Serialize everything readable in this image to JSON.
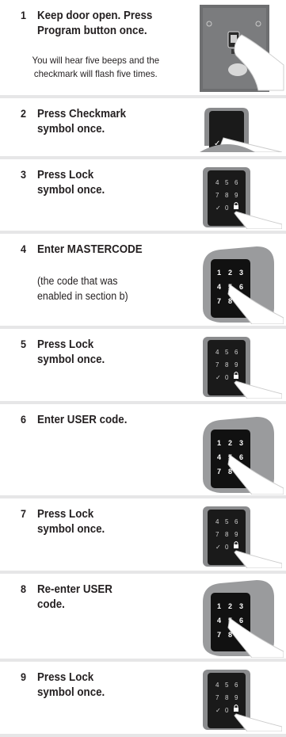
{
  "steps": [
    {
      "number": "1",
      "title_lines": [
        "Keep door open. Press",
        "Program button once."
      ],
      "note_lines": [
        "You will hear five beeps and the",
        "checkmark will flash five times."
      ]
    },
    {
      "number": "2",
      "title_lines": [
        "Press Checkmark",
        "symbol once."
      ]
    },
    {
      "number": "3",
      "title_lines": [
        "Press Lock",
        "symbol once."
      ],
      "keypad": [
        "4",
        "5",
        "6",
        "7",
        "8",
        "9",
        "✓",
        "0",
        "🔒"
      ]
    },
    {
      "number": "4",
      "title_lines": [
        "Enter MASTERCODE"
      ],
      "note_lines": [
        "(the code that was",
        "enabled in section b)"
      ],
      "keypad": [
        "1",
        "2",
        "3",
        "4",
        "5",
        "6",
        "7",
        "8"
      ]
    },
    {
      "number": "5",
      "title_lines": [
        "Press Lock",
        "symbol once."
      ],
      "keypad": [
        "4",
        "5",
        "6",
        "7",
        "8",
        "9",
        "✓",
        "0",
        "🔒"
      ]
    },
    {
      "number": "6",
      "title_lines": [
        "Enter USER code."
      ],
      "keypad": [
        "1",
        "2",
        "3",
        "4",
        "5",
        "6",
        "7",
        "8"
      ]
    },
    {
      "number": "7",
      "title_lines": [
        "Press Lock",
        "symbol once."
      ],
      "keypad": [
        "4",
        "5",
        "6",
        "7",
        "8",
        "9",
        "✓",
        "0",
        "🔒"
      ]
    },
    {
      "number": "8",
      "title_lines": [
        "Re-enter USER",
        "code."
      ],
      "keypad": [
        "1",
        "2",
        "3",
        "4",
        "5",
        "6",
        "7",
        "8"
      ]
    },
    {
      "number": "9",
      "title_lines": [
        "Press Lock",
        "symbol once."
      ],
      "keypad": [
        "4",
        "5",
        "6",
        "7",
        "8",
        "9",
        "✓",
        "0",
        "🔒"
      ]
    }
  ],
  "colors": {
    "panel_bg": "#e6e6e7",
    "card_bg": "#ffffff",
    "text": "#231f20",
    "lock_body": "#6d6e70",
    "keypad_face": "#1a1a1a"
  }
}
